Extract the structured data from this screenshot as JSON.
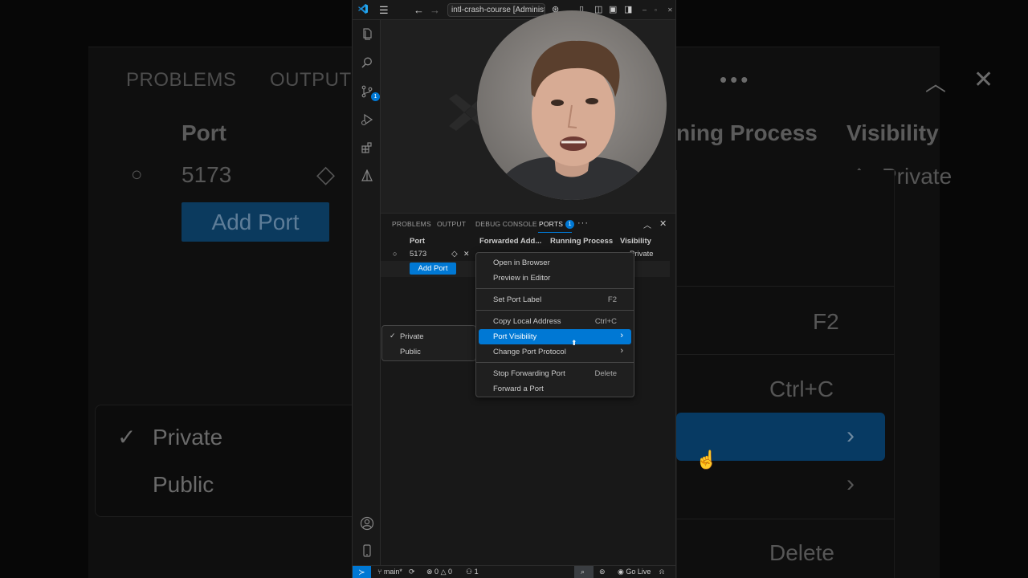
{
  "background": {
    "tabs": [
      "PROBLEMS",
      "OUTPUT"
    ],
    "port_header": "Port",
    "port_value": "5173",
    "add_port": "Add Port",
    "running_process_header": "ning Process",
    "visibility_header": "Visibility",
    "visibility_value": "Private",
    "sub_private": "Private",
    "sub_public": "Public",
    "kb_f2": "F2",
    "kb_copy": "Ctrl+C",
    "kb_delete": "Delete"
  },
  "titlebar": {
    "search_text": "intl-crash-course [Administrato"
  },
  "activity_badge": "1",
  "panel": {
    "tabs": [
      "PROBLEMS",
      "OUTPUT",
      "DEBUG CONSOLE",
      "PORTS"
    ],
    "ports_badge": "1",
    "columns": {
      "port": "Port",
      "forwarded_address": "Forwarded Add...",
      "running_process": "Running Process",
      "visibility": "Visibility"
    },
    "rows": [
      {
        "port": "5173",
        "visibility": "Private"
      }
    ],
    "add_port_label": "Add Port"
  },
  "context_menu": {
    "items": [
      {
        "label": "Open in Browser",
        "shortcut": ""
      },
      {
        "label": "Preview in Editor",
        "shortcut": ""
      },
      {
        "label": "Set Port Label",
        "shortcut": "F2"
      },
      {
        "label": "Copy Local Address",
        "shortcut": "Ctrl+C"
      },
      {
        "label": "Port Visibility",
        "shortcut": ""
      },
      {
        "label": "Change Port Protocol",
        "shortcut": ""
      },
      {
        "label": "Stop Forwarding Port",
        "shortcut": "Delete"
      },
      {
        "label": "Forward a Port",
        "shortcut": ""
      }
    ]
  },
  "visibility_submenu": {
    "items": [
      {
        "label": "Private",
        "checked": true
      },
      {
        "label": "Public",
        "checked": false
      }
    ]
  },
  "statusbar": {
    "branch": "main*",
    "errors": "0",
    "warnings": "0",
    "ports": "1",
    "go_live": "Go Live"
  },
  "colors": {
    "accent": "#0078d4",
    "panel_bg": "#181818",
    "editor_bg": "#1f1f1f"
  }
}
